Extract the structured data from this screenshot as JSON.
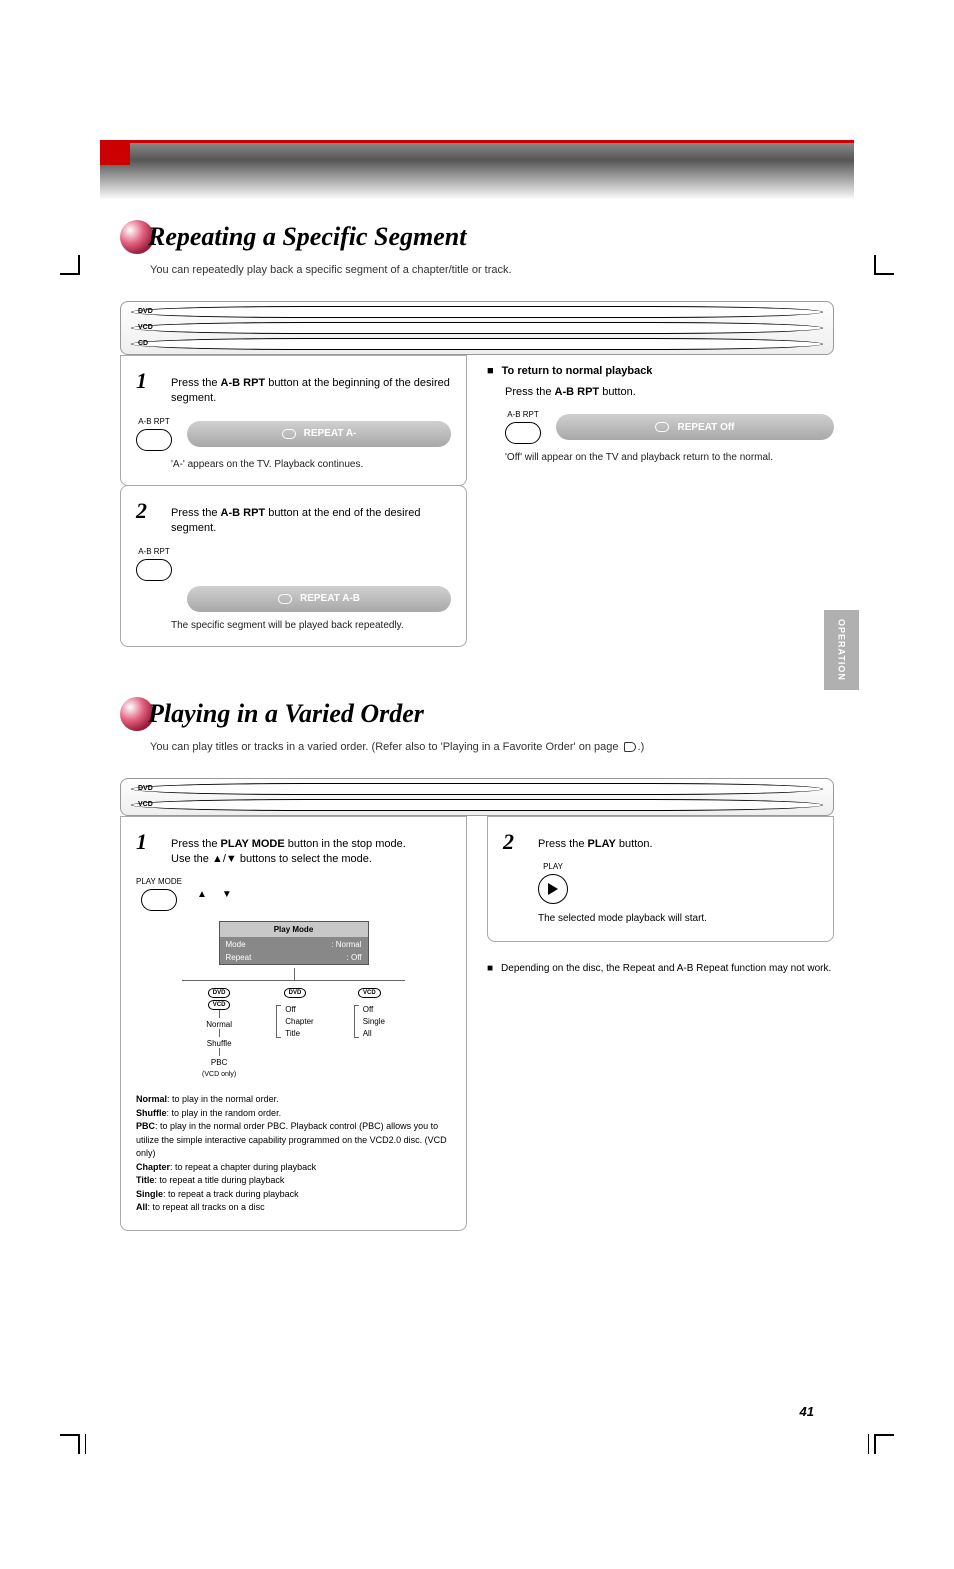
{
  "page_number": "41",
  "header_banner": {},
  "side_tab": "OPERATION",
  "section1": {
    "title": "Repeating a Specific Segment",
    "subtitle": "You can repeatedly play back a specific segment of a chapter/title or track.",
    "badges": [
      "DVD",
      "VCD",
      "CD"
    ],
    "step1": {
      "num": "1",
      "text_prefix": "Press the ",
      "text_bold": "A-B RPT",
      "text_suffix": " button at the beginning of the desired segment.",
      "btn_label": "A-B RPT",
      "osd": "REPEAT A-",
      "note": "'A-' appears on the TV. Playback continues."
    },
    "step2": {
      "num": "2",
      "text_prefix": "Press the ",
      "text_bold": "A-B RPT",
      "text_suffix": " button at the end of the desired segment.",
      "btn_label": "A-B RPT",
      "osd": "REPEAT A-B",
      "note": "The specific segment will be played back repeatedly."
    },
    "cancel": {
      "bullet_title": "To return to normal playback",
      "text_prefix": "Press the ",
      "text_bold": "A-B RPT",
      "text_suffix": " button.",
      "btn_label": "A-B RPT",
      "osd": "REPEAT Off",
      "note": "'Off' will appear on the TV and playback return to the normal."
    }
  },
  "section2": {
    "title": "Playing in a Varied Order",
    "subtitle_prefix": "You can play titles or tracks in a varied order. (Refer also to 'Playing in a Favorite Order' on page",
    "subtitle_suffix": ".)",
    "badges": [
      "DVD",
      "VCD"
    ],
    "step1": {
      "num": "1",
      "text_line1_prefix": "Press the ",
      "text_line1_bold": "PLAY MODE",
      "text_line1_suffix": " button in the stop mode.",
      "text_line2": "Use the ▲/▼ buttons to select the mode.",
      "btn_label": "PLAY MODE",
      "menu_title": "Play Mode",
      "menu_row1_label": "Mode",
      "menu_row1_val": ": Normal",
      "menu_row2_label": "Repeat",
      "menu_row2_val": ": Off",
      "tree": {
        "col1": {
          "badges": [
            "DVD",
            "VCD"
          ],
          "nodes": [
            "Normal",
            "Shuffle",
            "PBC",
            "(VCD only)"
          ]
        },
        "col2": {
          "badges": [
            "DVD"
          ],
          "nodes": [
            "Off",
            "Chapter",
            "Title"
          ]
        },
        "col3": {
          "badges": [
            "VCD"
          ],
          "nodes": [
            "Off",
            "Single",
            "All"
          ]
        }
      },
      "desc_normal_b": "Normal",
      "desc_normal": ": to play in the normal order.",
      "desc_shuffle_b": "Shuffle",
      "desc_shuffle": ": to play in the random order.",
      "desc_pbc_b": "PBC",
      "desc_pbc": ": to play in the normal order PBC. Playback control (PBC) allows you to utilize the simple interactive capability programmed on the VCD2.0 disc. (VCD only)",
      "desc_chapter_b": "Chapter",
      "desc_chapter": ": to repeat a chapter during playback",
      "desc_title_b": "Title",
      "desc_title": ": to repeat a title during playback",
      "desc_single_b": "Single",
      "desc_single": ": to repeat a track during playback",
      "desc_all_b": "All",
      "desc_all": ": to repeat all tracks on a disc"
    },
    "step2": {
      "num": "2",
      "text_prefix": "Press the ",
      "text_bold": "PLAY",
      "text_suffix": " button.",
      "btn_label": "PLAY",
      "note": "The selected mode playback will start."
    },
    "note": {
      "title": "Depending on the disc, the Repeat and A-B Repeat function may not work."
    }
  }
}
